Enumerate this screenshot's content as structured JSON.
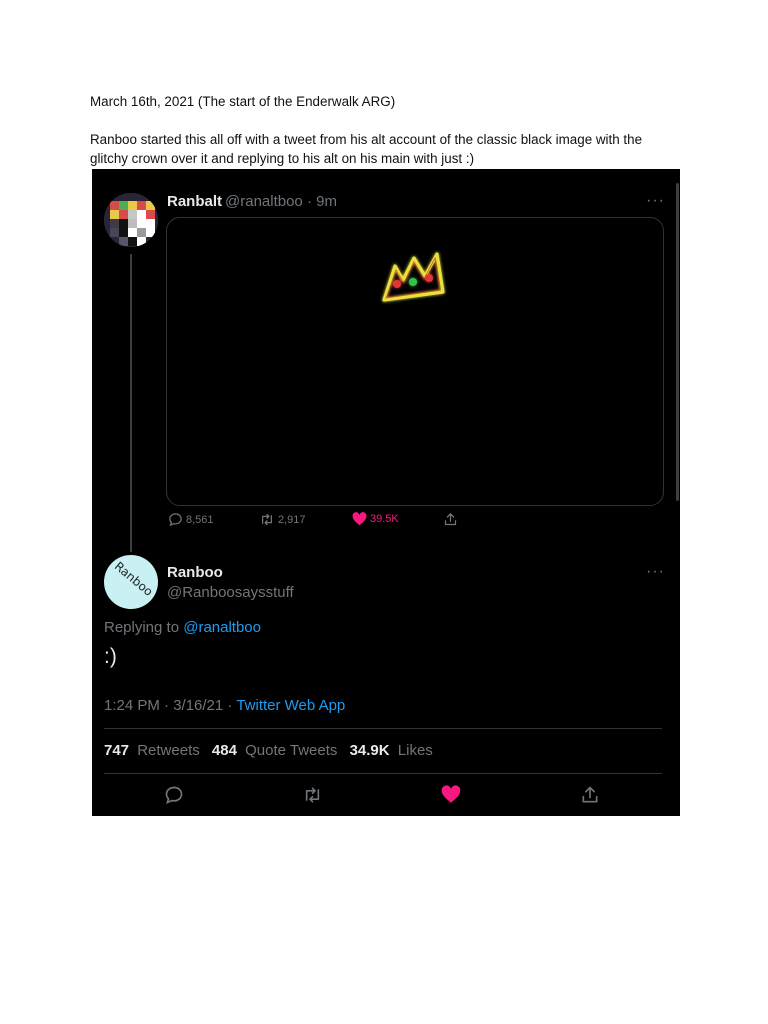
{
  "document": {
    "heading": "March 16th, 2021 (The start of the Enderwalk ARG)",
    "paragraph_line1": "Ranboo started this all off with a tweet from his alt account of the classic black image with the",
    "paragraph_line2": "glitchy crown over it and replying to his alt on his main with just :)"
  },
  "tweet1": {
    "name": "Ranbalt",
    "handle": "@ranaltboo",
    "separator": "·",
    "time": "9m",
    "more": "···",
    "replies": "8,561",
    "retweets": "2,917",
    "likes": "39.5K"
  },
  "tweet2": {
    "name": "Ranboo",
    "handle": "@Ranboosaysstuff",
    "more": "···",
    "avatar_text": "Ranboo",
    "replying_prefix": "Replying to",
    "replying_to": "@ranaltboo",
    "text": ":)",
    "timestamp": "1:24 PM · 3/16/21 ·",
    "source": "Twitter Web App",
    "retweet_count": "747",
    "retweet_label": "Retweets",
    "quote_count": "484",
    "quote_label": "Quote Tweets",
    "like_count": "34.9K",
    "like_label": "Likes"
  },
  "colors": {
    "background": "#000000",
    "text_primary": "#e7e9ea",
    "text_secondary": "#71767b",
    "link": "#1d9bf0",
    "like": "#f91880"
  },
  "icons": [
    "reply-icon",
    "retweet-icon",
    "heart-icon",
    "share-icon",
    "crown-image"
  ]
}
